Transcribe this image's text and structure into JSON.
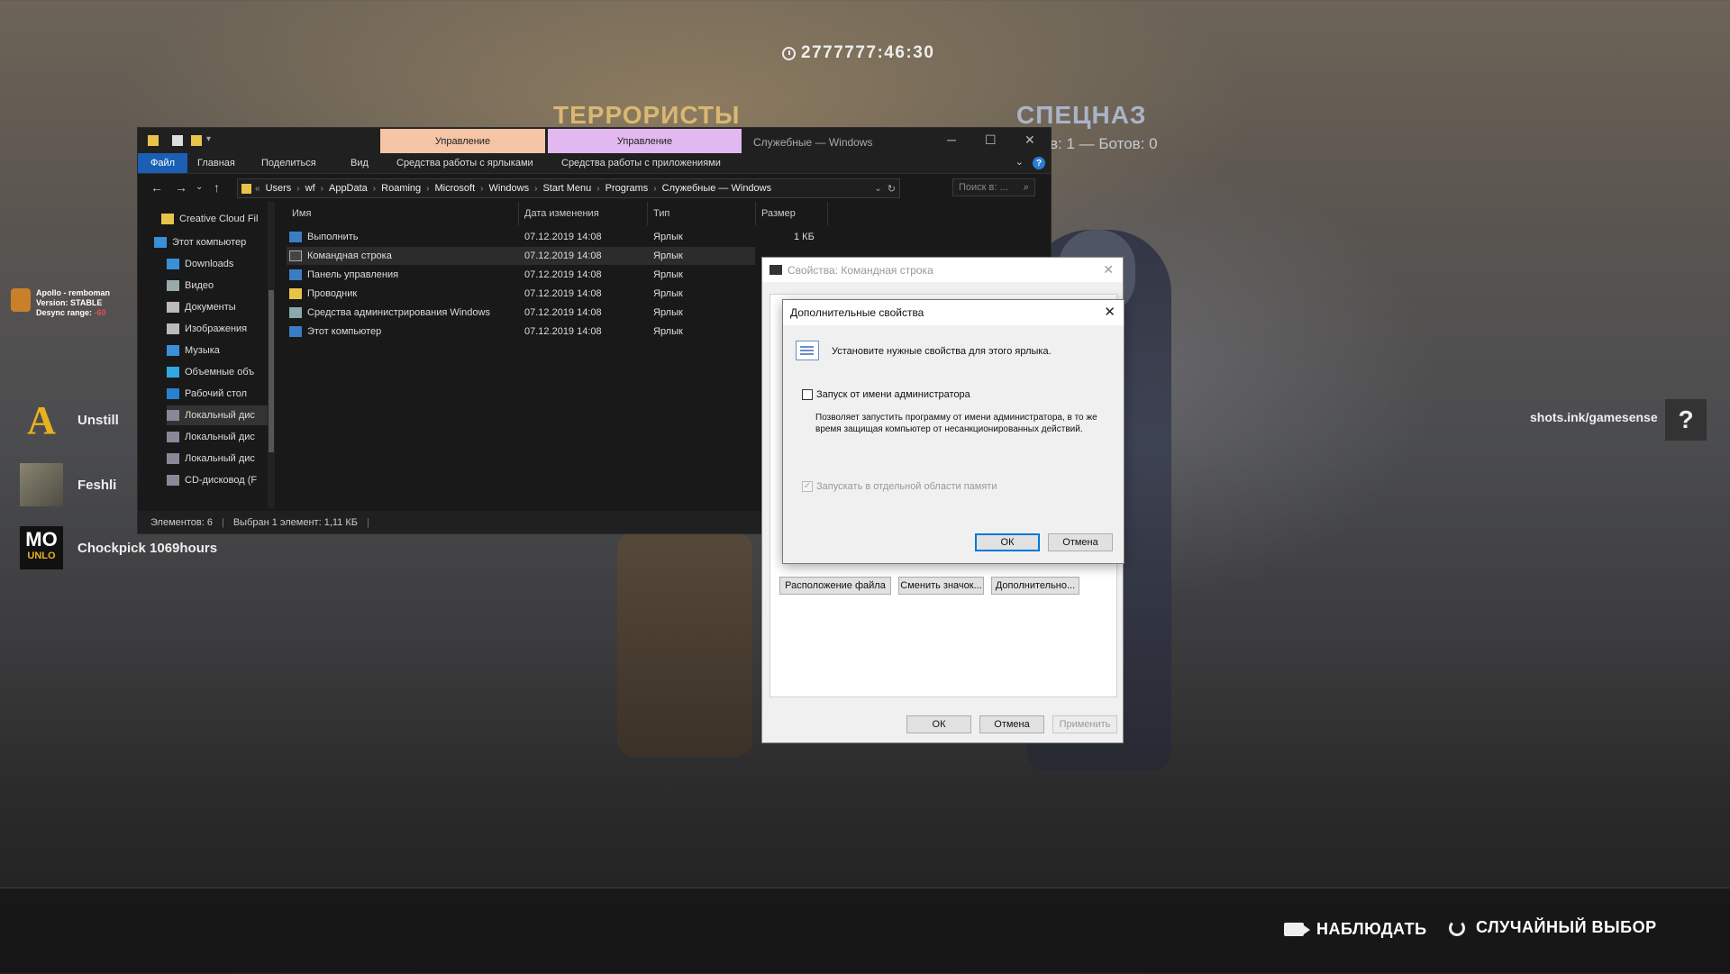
{
  "hud": {
    "timer": "2777777:46:30",
    "team_t": "ТЕРРОРИСТЫ",
    "team_ct": "СПЕЦНАЗ",
    "ct_sub": "в: 1 — Ботов: 0",
    "promo": "shots.ink/gamesense",
    "help": "?",
    "spectate": "НАБЛЮДАТЬ",
    "random": "СЛУЧАЙНЫЙ ВЫБОР"
  },
  "cheat": {
    "line1": "Apollo - remboman",
    "line2": "Version: STABLE",
    "line3_label": "Desync range:",
    "line3_value": "-60"
  },
  "players": [
    {
      "name": "Unstill",
      "avatar": "A"
    },
    {
      "name": "Feshli",
      "avatar": ""
    },
    {
      "name": "Chockpick 1069hours",
      "avatar_top": "MO",
      "avatar_bottom": "UNLO"
    }
  ],
  "explorer": {
    "title": "Служебные — Windows",
    "context_tab_1": "Управление",
    "context_tab_2": "Управление",
    "ribbon": {
      "file": "Файл",
      "home": "Главная",
      "share": "Поделиться",
      "view": "Вид",
      "shortcut_tools": "Средства работы с ярлыками",
      "app_tools": "Средства работы с приложениями"
    },
    "address": [
      "Users",
      "wf",
      "AppData",
      "Roaming",
      "Microsoft",
      "Windows",
      "Start Menu",
      "Programs",
      "Служебные — Windows"
    ],
    "search_placeholder": "Поиск в: ...",
    "nav": [
      "Creative Cloud Fil",
      "Этот компьютер",
      "Downloads",
      "Видео",
      "Документы",
      "Изображения",
      "Музыка",
      "Объемные объ",
      "Рабочий стол",
      "Локальный дис",
      "Локальный дис",
      "Локальный дис",
      "CD-дисковод (F"
    ],
    "columns": {
      "name": "Имя",
      "date": "Дата изменения",
      "type": "Тип",
      "size": "Размер"
    },
    "files": [
      {
        "name": "Выполнить",
        "date": "07.12.2019 14:08",
        "type": "Ярлык",
        "size": "1 КБ"
      },
      {
        "name": "Командная строка",
        "date": "07.12.2019 14:08",
        "type": "Ярлык",
        "size": ""
      },
      {
        "name": "Панель управления",
        "date": "07.12.2019 14:08",
        "type": "Ярлык",
        "size": ""
      },
      {
        "name": "Проводник",
        "date": "07.12.2019 14:08",
        "type": "Ярлык",
        "size": ""
      },
      {
        "name": "Средства администрирования Windows",
        "date": "07.12.2019 14:08",
        "type": "Ярлык",
        "size": ""
      },
      {
        "name": "Этот компьютер",
        "date": "07.12.2019 14:08",
        "type": "Ярлык",
        "size": ""
      }
    ],
    "status_count": "Элементов: 6",
    "status_selected": "Выбран 1 элемент: 1,11 КБ"
  },
  "props": {
    "title": "Свойства: Командная строка",
    "btn_location": "Расположение файла",
    "btn_icon": "Сменить значок...",
    "btn_advanced": "Дополнительно...",
    "ok": "ОК",
    "cancel": "Отмена",
    "apply": "Применить"
  },
  "advanced": {
    "title": "Дополнительные свойства",
    "prompt": "Установите нужные свойства для этого ярлыка.",
    "run_as_admin": "Запуск от имени администратора",
    "description": "Позволяет запустить программу от имени администратора, в то же время защищая компьютер от несанкционированных действий.",
    "separate_memory": "Запускать в отдельной области памяти",
    "ok": "ОК",
    "cancel": "Отмена"
  },
  "colors": {
    "team_t": "#d9b872",
    "team_ct": "#aab3c8",
    "ctx_tab_1": "#f5c5a5",
    "ctx_tab_2": "#e2b8f0",
    "accent_blue": "#1a5fb4"
  }
}
